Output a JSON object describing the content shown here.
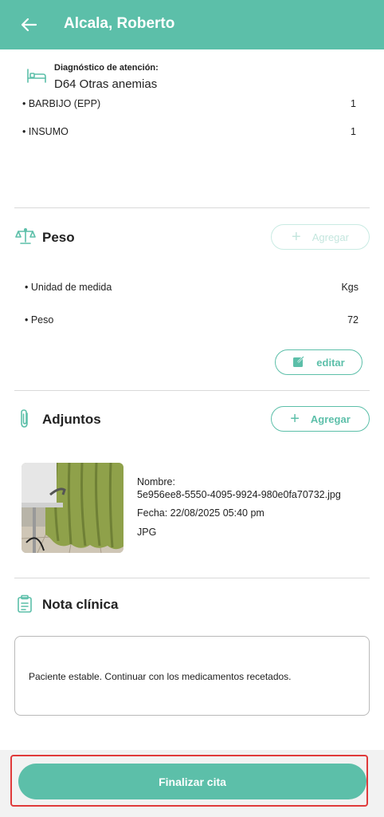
{
  "header": {
    "title": "Alcala, Roberto"
  },
  "diagnosis": {
    "label": "Diagnóstico de atención:",
    "value": "D64 Otras anemias"
  },
  "supplies": [
    {
      "name": "• BARBIJO (EPP)",
      "qty": "1"
    },
    {
      "name": "• INSUMO",
      "qty": "1"
    }
  ],
  "weight": {
    "title": "Peso",
    "add_label": "Agregar",
    "rows": [
      {
        "label": "• Unidad de medida",
        "value": "Kgs"
      },
      {
        "label": "• Peso",
        "value": "72"
      }
    ],
    "edit_label": "editar"
  },
  "attachments": {
    "title": "Adjuntos",
    "add_label": "Agregar",
    "file": {
      "name_label": "Nombre:",
      "name": "5e956ee8-5550-4095-9924-980e0fa70732.jpg",
      "date": "Fecha: 22/08/2025 05:40 pm",
      "type": "JPG"
    }
  },
  "clinical_note": {
    "title": "Nota clínica",
    "text": "Paciente estable. Continuar con los medicamentos recetados."
  },
  "footer": {
    "finalize_label": "Finalizar cita"
  },
  "colors": {
    "accent": "#5cbfa9",
    "highlight": "#e03a3a"
  }
}
